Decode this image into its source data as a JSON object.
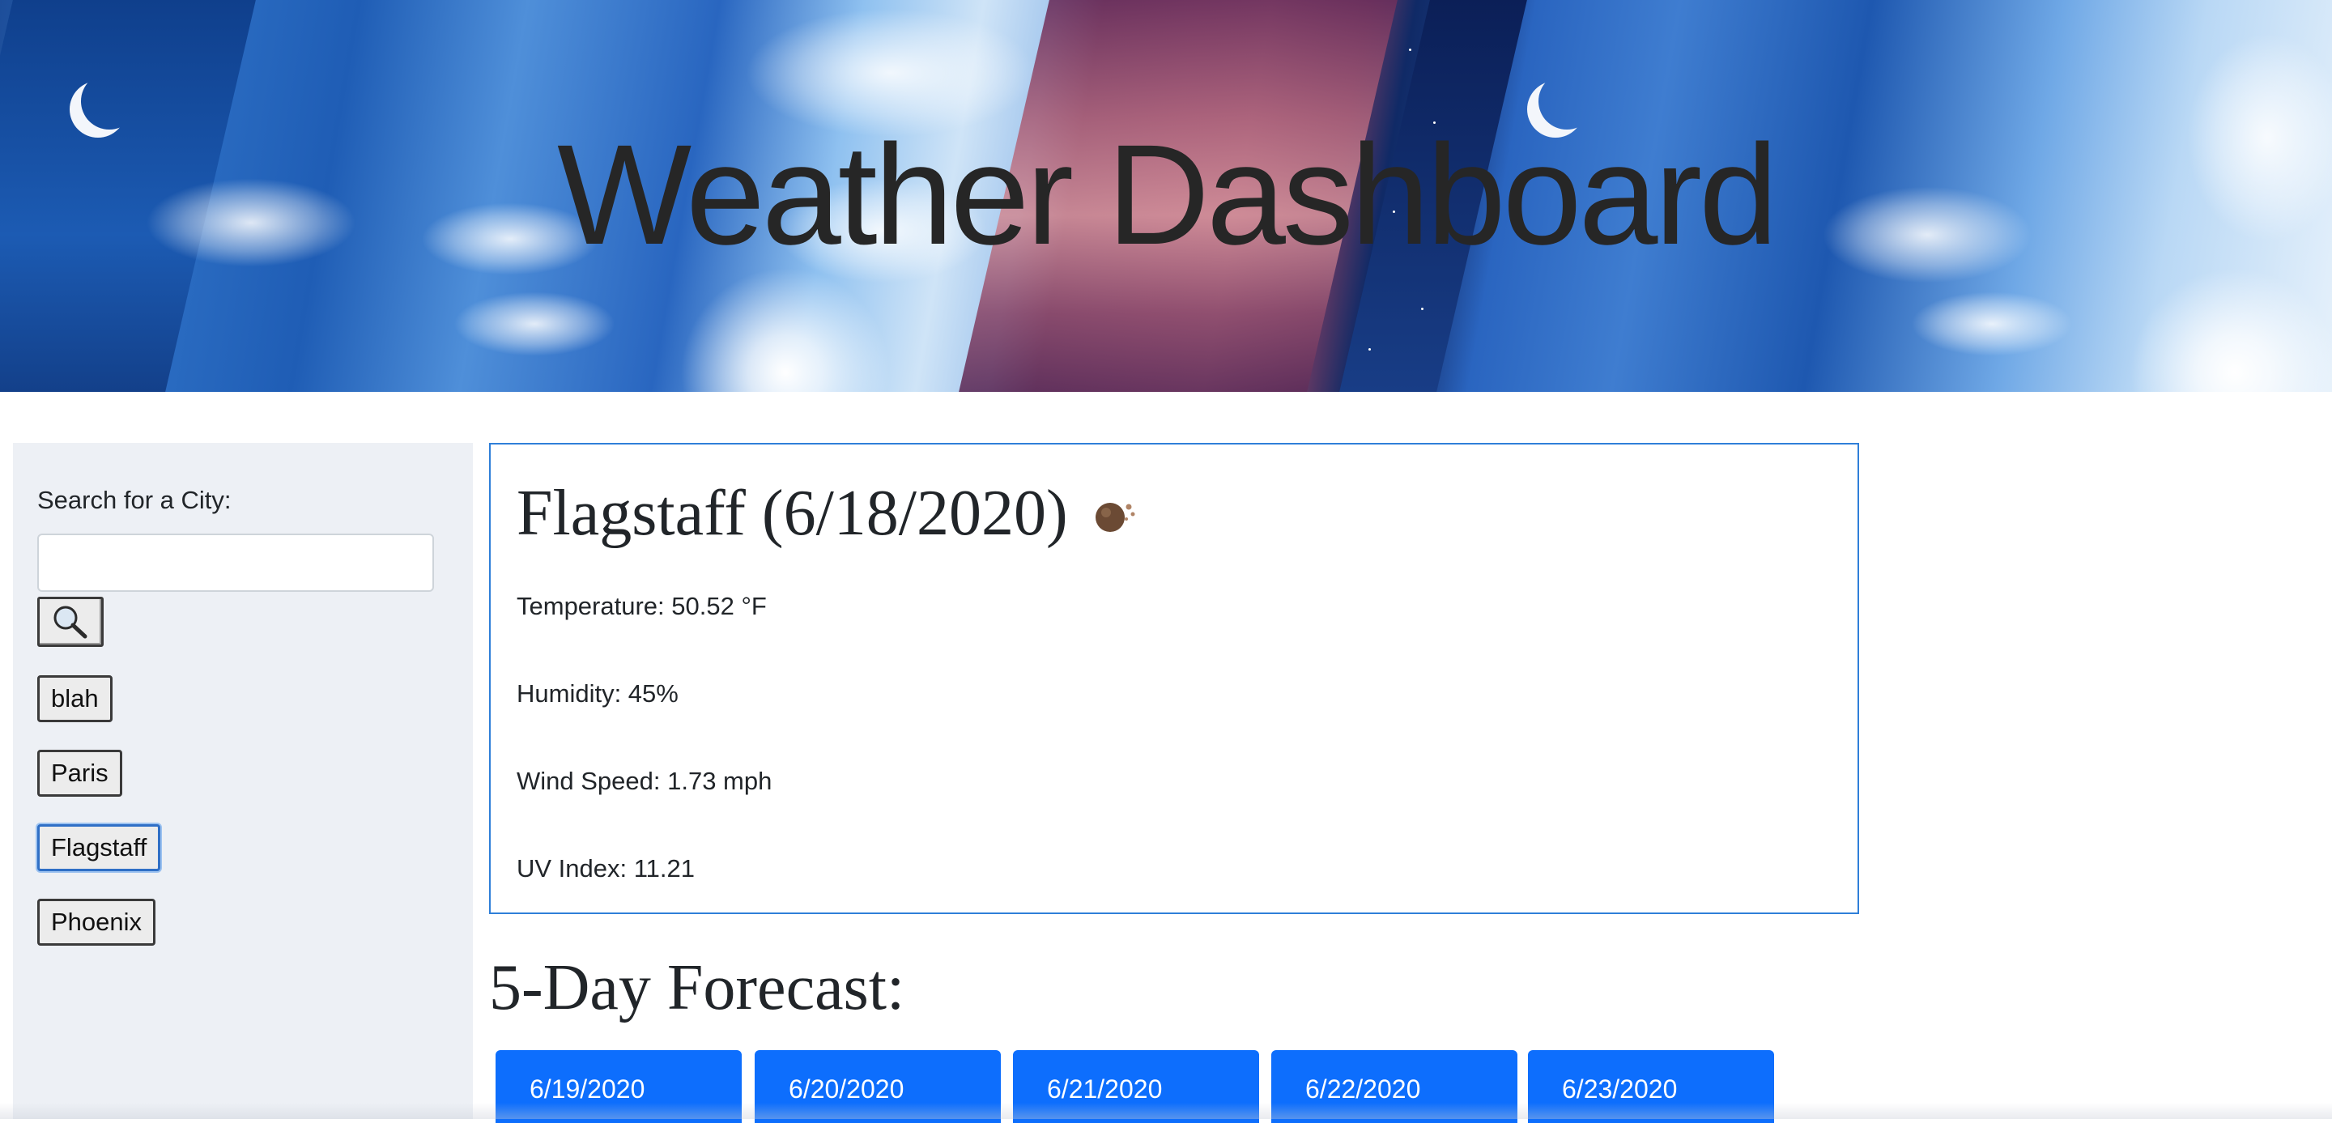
{
  "header": {
    "title": "Weather Dashboard"
  },
  "sidebar": {
    "search_label": "Search for a City:",
    "search_value": "",
    "search_button_icon": "magnifier-icon",
    "history": [
      {
        "label": "blah",
        "active": false
      },
      {
        "label": "Paris",
        "active": false
      },
      {
        "label": "Flagstaff",
        "active": true
      },
      {
        "label": "Phoenix",
        "active": false
      }
    ]
  },
  "current": {
    "title": "Flagstaff (6/18/2020)",
    "icon": "weather-icon",
    "temperature": "Temperature: 50.52 °F",
    "humidity": "Humidity: 45%",
    "wind": "Wind Speed: 1.73 mph",
    "uv": "UV Index: 11.21"
  },
  "forecast": {
    "title": "5-Day Forecast:",
    "days": [
      {
        "date": "6/19/2020"
      },
      {
        "date": "6/20/2020"
      },
      {
        "date": "6/21/2020"
      },
      {
        "date": "6/22/2020"
      },
      {
        "date": "6/23/2020"
      }
    ]
  },
  "colors": {
    "accent": "#0d6efd",
    "card_border": "#2f7fd9",
    "sidebar_bg": "#edf0f5"
  }
}
